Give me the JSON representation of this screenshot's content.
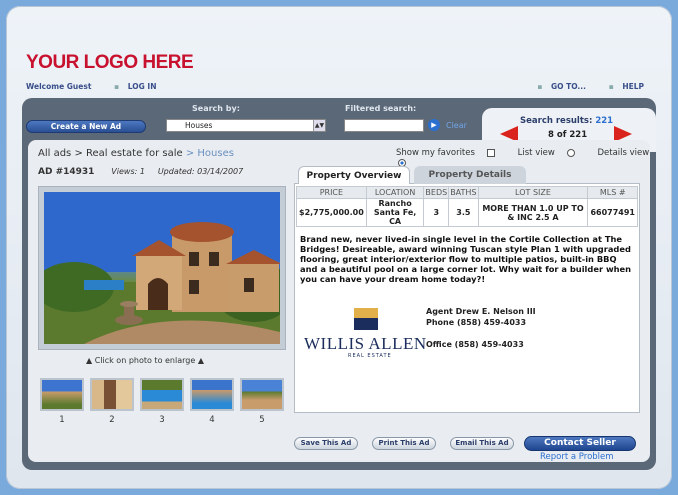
{
  "header": {
    "logo_text": "YOUR LOGO HERE",
    "welcome": "Welcome Guest",
    "login": "LOG IN",
    "goto": "GO TO...",
    "help": "HELP"
  },
  "search": {
    "create_button": "Create a New Ad",
    "search_by_label": "Search by:",
    "search_by_value": "Houses",
    "filtered_label": "Filtered search:",
    "filter_value": "",
    "clear": "Clear",
    "results_label": "Search results:",
    "results_total": "221",
    "results_position": "8 of 221"
  },
  "breadcrumb": {
    "part1": "All ads",
    "sep": ">",
    "part2": "Real estate for sale",
    "part3": "> Houses"
  },
  "ad": {
    "id": "AD #14931",
    "views": "Views: 1",
    "updated": "Updated: 03/14/2007"
  },
  "view_options": {
    "favorites": "Show my favorites",
    "list_view": "List view",
    "details_view": "Details view"
  },
  "photo": {
    "enlarge_text": "Click on photo to enlarge",
    "thumb_numbers": [
      "1",
      "2",
      "3",
      "4",
      "5"
    ]
  },
  "tabs": {
    "overview": "Property Overview",
    "details": "Property Details"
  },
  "specs": {
    "headers": [
      "PRICE",
      "LOCATION",
      "BEDS",
      "BATHS",
      "LOT SIZE",
      "MLS #"
    ],
    "values": [
      "$2,775,000.00",
      "Rancho Santa Fe, CA",
      "3",
      "3.5",
      "MORE THAN 1.0 UP TO & INC 2.5 A",
      "66077491"
    ]
  },
  "description": "Brand new, never lived-in single level in the Cortile Collection at The Bridges! Desireable, award winning Tuscan style Plan 1 with upgraded flooring, great interior/exterior flow to multiple patios, built-in BBQ and a beautiful pool on a large corner lot. Why wait for a builder when you can have your dream home today?!",
  "agent": {
    "name": "Agent Drew E. Nelson III",
    "phone": "Phone (858) 459-4033",
    "office": "Office (858) 459-4033",
    "brand": "WILLIS ALLEN",
    "brand_sub": "REAL ESTATE"
  },
  "actions": {
    "save": "Save This Ad",
    "print": "Print This Ad",
    "email": "Email This Ad",
    "contact": "Contact Seller",
    "report": "Report a Problem"
  },
  "colors": {
    "logo_red": "#c8112e",
    "accent_blue": "#2b6fcf",
    "arrow_red": "#d9231c",
    "panel_dark": "#5b6878"
  }
}
